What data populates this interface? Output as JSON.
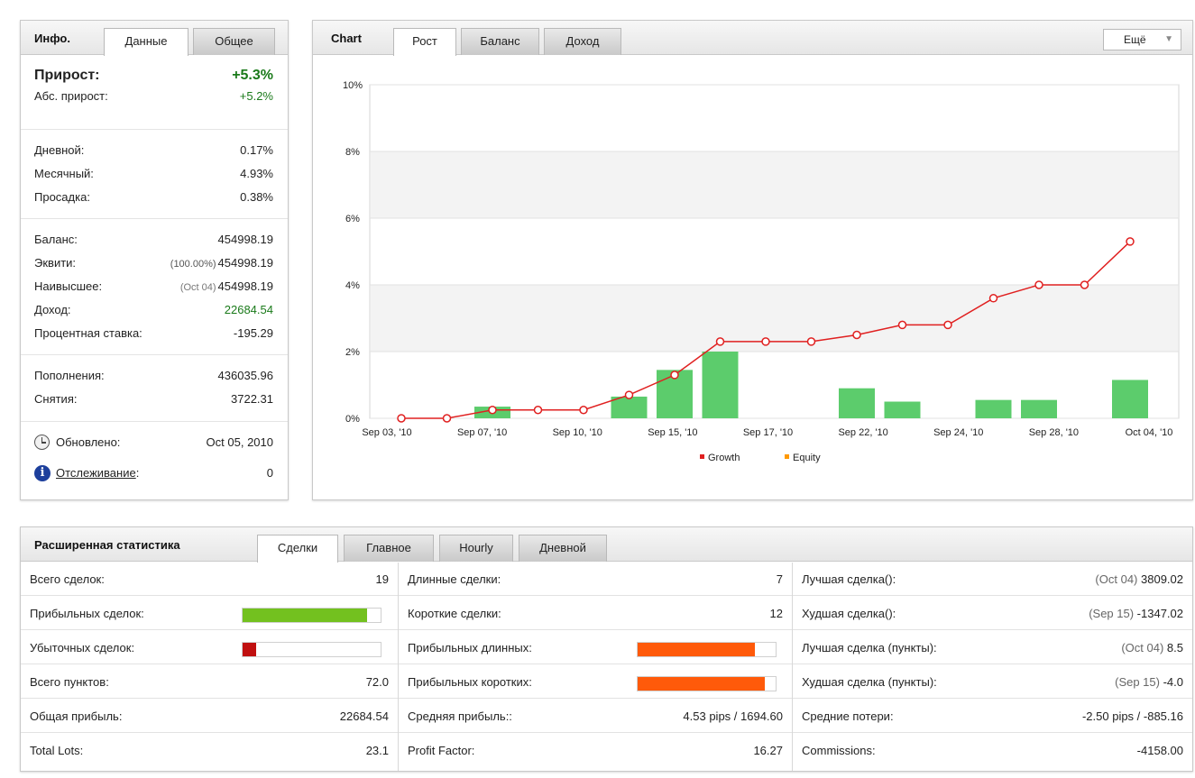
{
  "colors": {
    "green": "#1a7a1a",
    "bar_green": "#5ccc6c",
    "growth_line": "#e02020",
    "equity": "#ff9900",
    "profit_bar": "#73c11f",
    "loss_bar": "#c01010",
    "orange_bar": "#ff5a0a"
  },
  "info": {
    "title": "Инфо.",
    "tabs": [
      "Данные",
      "Общее"
    ],
    "growth": {
      "label": "Прирост:",
      "value": "+5.3%"
    },
    "abs_growth": {
      "label": "Абс. прирост:",
      "value": "+5.2%"
    },
    "daily": {
      "label": "Дневной:",
      "value": "0.17%"
    },
    "monthly": {
      "label": "Месячный:",
      "value": "4.93%"
    },
    "drawdown": {
      "label": "Просадка:",
      "value": "0.38%"
    },
    "balance": {
      "label": "Баланс:",
      "value": "454998.19"
    },
    "equity": {
      "label": "Эквити:",
      "note": "(100.00%)",
      "value": "454998.19"
    },
    "highest": {
      "label": "Наивысшее:",
      "note": "(Oct 04)",
      "value": "454998.19"
    },
    "profit": {
      "label": "Доход:",
      "value": "22684.54"
    },
    "interest": {
      "label": "Процентная ставка:",
      "value": "-195.29"
    },
    "deposits": {
      "label": "Пополнения:",
      "value": "436035.96"
    },
    "withdrawals": {
      "label": "Снятия:",
      "value": "3722.31"
    },
    "updated": {
      "label": "Обновлено:",
      "value": "Oct 05, 2010"
    },
    "tracking": {
      "label": "Отслеживание",
      "colon": ":",
      "value": "0"
    }
  },
  "chart_panel": {
    "title": "Chart",
    "tabs": [
      "Рост",
      "Баланс",
      "Доход"
    ],
    "more_label": "Ещё",
    "more_icon": "chevron-down-icon"
  },
  "chart_data": {
    "type": "line",
    "ylim": [
      0,
      10
    ],
    "y_ticks": [
      "0%",
      "2%",
      "4%",
      "6%",
      "8%",
      "10%"
    ],
    "x_tick_labels": [
      "Sep 03, '10",
      "Sep 07, '10",
      "Sep 10, '10",
      "Sep 15, '10",
      "Sep 17, '10",
      "Sep 22, '10",
      "Sep 24, '10",
      "Sep 28, '10",
      "Oct 04, '10"
    ],
    "legend_position": "bottom",
    "series": [
      {
        "name": "Growth",
        "type": "line",
        "color": "#e02020",
        "values": [
          0,
          0,
          0.25,
          0.25,
          0.25,
          0.7,
          1.3,
          2.3,
          2.3,
          2.3,
          2.5,
          2.8,
          2.8,
          3.6,
          4.0,
          4.0,
          5.3
        ]
      },
      {
        "name": "Equity",
        "type": "legend-only",
        "color": "#ff9900"
      }
    ],
    "bars": {
      "type": "bar",
      "color": "#5ccc6c",
      "values": [
        0,
        0,
        0.35,
        0,
        0,
        0.65,
        1.45,
        2.0,
        0,
        0,
        0.9,
        0.5,
        0,
        0.55,
        0.55,
        0,
        1.15
      ]
    }
  },
  "stats": {
    "title": "Расширенная статистика",
    "tabs": [
      "Сделки",
      "Главное",
      "Hourly",
      "Дневной"
    ],
    "col1": [
      {
        "label": "Всего сделок:",
        "value": "19"
      },
      {
        "label": "Прибыльных сделок:",
        "bar": 0.9,
        "bar_color": "#73c11f"
      },
      {
        "label": "Убыточных сделок:",
        "bar": 0.1,
        "bar_color": "#c01010"
      },
      {
        "label": "Всего пунктов:",
        "value": "72.0"
      },
      {
        "label": "Общая прибыль:",
        "value": "22684.54"
      },
      {
        "label": "Total Lots:",
        "value": "23.1"
      }
    ],
    "col2": [
      {
        "label": "Длинные сделки:",
        "value": "7"
      },
      {
        "label": "Короткие сделки:",
        "value": "12"
      },
      {
        "label": "Прибыльных длинных:",
        "bar": 0.85,
        "bar_color": "#ff5a0a"
      },
      {
        "label": "Прибыльных коротких:",
        "bar": 0.92,
        "bar_color": "#ff5a0a"
      },
      {
        "label": "Средняя прибыль::",
        "value": "4.53 pips / 1694.60"
      },
      {
        "label": "Profit Factor:",
        "value": "16.27"
      }
    ],
    "col3": [
      {
        "label": "Лучшая сделка():",
        "note": "(Oct 04)",
        "value": "3809.02"
      },
      {
        "label": "Худшая сделка():",
        "note": "(Sep 15)",
        "value": "-1347.02"
      },
      {
        "label": "Лучшая сделка (пункты):",
        "note": "(Oct 04)",
        "value": "8.5"
      },
      {
        "label": "Худшая сделка (пункты):",
        "note": "(Sep 15)",
        "value": "-4.0"
      },
      {
        "label": "Средние потери:",
        "value": "-2.50 pips / -885.16"
      },
      {
        "label": "Commissions:",
        "value": "-4158.00"
      }
    ]
  }
}
